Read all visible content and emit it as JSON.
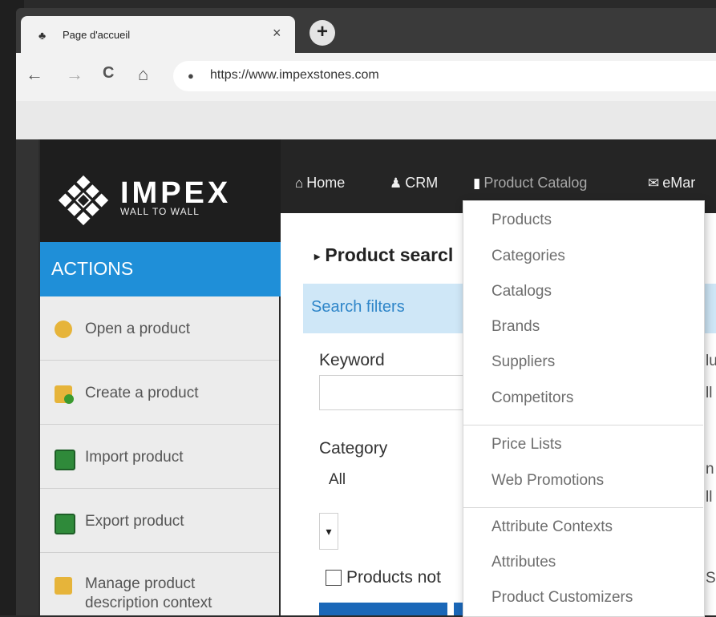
{
  "browser": {
    "tab_title": "Page d'accueil",
    "tab_close": "×",
    "new_tab": "+",
    "url": "https://www.impexstones.com",
    "back": "←",
    "forward": "→",
    "reload": "C",
    "home": "⌂",
    "lock": "🔒"
  },
  "logo": {
    "name": "IMPEX",
    "tagline": "WALL TO WALL"
  },
  "topnav": {
    "home": "Home",
    "crm": "CRM",
    "product_catalog": "Product Catalog",
    "emarketing": "eMar"
  },
  "sidebar": {
    "header": "ACTIONS",
    "items": [
      {
        "label": "Open a product"
      },
      {
        "label": "Create a product"
      },
      {
        "label": "Import product"
      },
      {
        "label": "Export product"
      },
      {
        "label_line1": "Manage product",
        "label_line2": "description context"
      }
    ]
  },
  "main": {
    "title": "Product searcl",
    "collapse_glyph": "▸",
    "filters_label": "Search filters",
    "keyword_label": "Keyword",
    "category_label": "Category",
    "category_value": "All",
    "small_select_glyph": "▾",
    "checkbox_label": "Products not",
    "right_fragments": {
      "a": "lu",
      "b": "ll",
      "c": "n",
      "d": "ll",
      "e": "S"
    }
  },
  "dropdown": {
    "group1": [
      "Products",
      "Categories",
      "Catalogs",
      "Brands",
      "Suppliers",
      "Competitors"
    ],
    "group2": [
      "Price Lists",
      "Web Promotions"
    ],
    "group3": [
      "Attribute Contexts",
      "Attributes",
      "Product Customizers"
    ]
  },
  "colors": {
    "accent": "#1f8fd8",
    "filters_bg": "#cfe7f7",
    "nav_bg": "#252525"
  }
}
